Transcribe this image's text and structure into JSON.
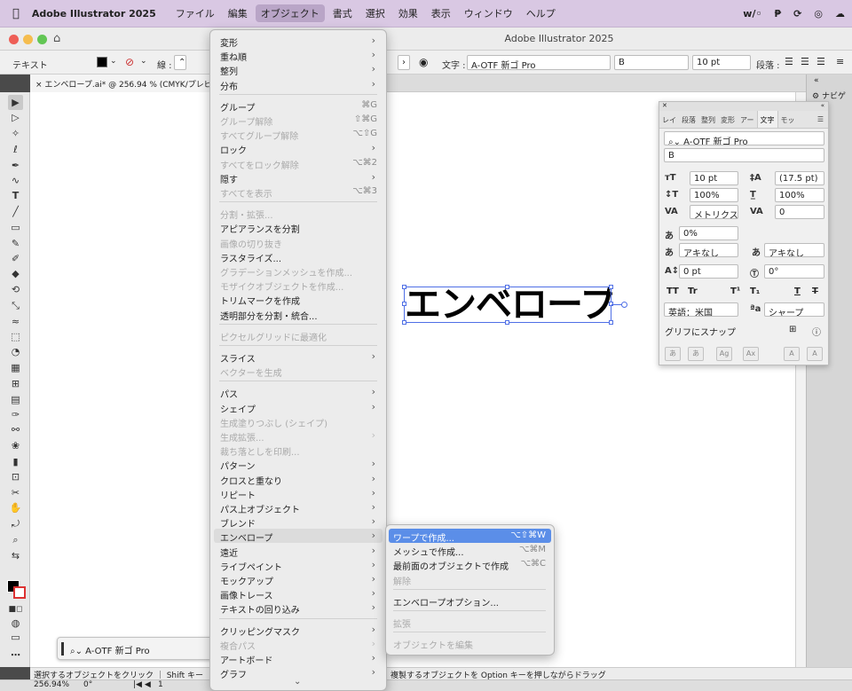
{
  "menubar": {
    "app": "Adobe Illustrator 2025",
    "items": [
      "ファイル",
      "編集",
      "オブジェクト",
      "書式",
      "選択",
      "効果",
      "表示",
      "ウィンドウ",
      "ヘルプ"
    ],
    "active_index": 2
  },
  "window": {
    "title": "Adobe Illustrator 2025"
  },
  "control": {
    "label": "テキスト",
    "stroke_label": "線 :",
    "char_label": "文字 :",
    "font": "A-OTF 新ゴ Pro",
    "style": "B",
    "size": "10 pt",
    "para_label": "段落 :"
  },
  "document": {
    "tab": "エンベロープ.ai* @ 256.94 % (CMYK/プレビュー)",
    "text": "エンベロープ"
  },
  "navigator": {
    "label": "ナビゲ"
  },
  "floating": {
    "font": "A-OTF 新ゴ Pro"
  },
  "char_panel": {
    "tabs": [
      "レイ",
      "段落",
      "整列",
      "変形",
      "アー",
      "文字",
      "モッ"
    ],
    "active_tab": 5,
    "font": "A-OTF 新ゴ Pro",
    "style": "B",
    "size": "10 pt",
    "leading": "(17.5 pt)",
    "vscale": "100%",
    "hscale": "100%",
    "kerning": "メトリクス",
    "tracking": "0",
    "tsume": "0%",
    "aki_left": "アキなし",
    "aki_right": "アキなし",
    "baseline": "0 pt",
    "rotation": "0°",
    "language": "英語：米国",
    "antialias": "シャープ",
    "glyph_snap": "グリフにスナップ",
    "fmt": {
      "tt": "TT",
      "tr": "Tr",
      "sup": "T¹",
      "sub": "T₁",
      "und": "T",
      "strike": "T"
    }
  },
  "menu": {
    "items": [
      {
        "label": "変形",
        "arrow": true
      },
      {
        "label": "重ね順",
        "arrow": true
      },
      {
        "label": "整列",
        "arrow": true
      },
      {
        "label": "分布",
        "arrow": true
      },
      {
        "sep": true
      },
      {
        "label": "グループ",
        "shortcut": "⌘G"
      },
      {
        "label": "グループ解除",
        "shortcut": "⇧⌘G",
        "disabled": true
      },
      {
        "label": "すべてグループ解除",
        "shortcut": "⌥⇧G",
        "disabled": true
      },
      {
        "label": "ロック",
        "arrow": true
      },
      {
        "label": "すべてをロック解除",
        "shortcut": "⌥⌘2",
        "disabled": true
      },
      {
        "label": "隠す",
        "arrow": true
      },
      {
        "label": "すべてを表示",
        "shortcut": "⌥⌘3",
        "disabled": true
      },
      {
        "sep": true
      },
      {
        "label": "分割・拡張...",
        "disabled": true
      },
      {
        "label": "アピアランスを分割"
      },
      {
        "label": "画像の切り抜き",
        "disabled": true
      },
      {
        "label": "ラスタライズ..."
      },
      {
        "label": "グラデーションメッシュを作成...",
        "disabled": true
      },
      {
        "label": "モザイクオブジェクトを作成...",
        "disabled": true
      },
      {
        "label": "トリムマークを作成"
      },
      {
        "label": "透明部分を分割・統合..."
      },
      {
        "sep": true
      },
      {
        "label": "ピクセルグリッドに最適化",
        "disabled": true
      },
      {
        "sep": true
      },
      {
        "label": "スライス",
        "arrow": true
      },
      {
        "label": "ベクターを生成",
        "disabled": true
      },
      {
        "sep": true
      },
      {
        "label": "パス",
        "arrow": true
      },
      {
        "label": "シェイプ",
        "arrow": true
      },
      {
        "label": "生成塗りつぶし (シェイプ)",
        "disabled": true
      },
      {
        "label": "生成拡張...",
        "arrow": true,
        "disabled": true
      },
      {
        "label": "裁ち落としを印刷...",
        "disabled": true
      },
      {
        "label": "パターン",
        "arrow": true
      },
      {
        "label": "クロスと重なり",
        "arrow": true
      },
      {
        "label": "リピート",
        "arrow": true
      },
      {
        "label": "パス上オブジェクト",
        "arrow": true
      },
      {
        "label": "ブレンド",
        "arrow": true
      },
      {
        "label": "エンベロープ",
        "arrow": true,
        "highlight": true
      },
      {
        "label": "遠近",
        "arrow": true
      },
      {
        "label": "ライブペイント",
        "arrow": true
      },
      {
        "label": "モックアップ",
        "arrow": true
      },
      {
        "label": "画像トレース",
        "arrow": true
      },
      {
        "label": "テキストの回り込み",
        "arrow": true
      },
      {
        "sep": true
      },
      {
        "label": "クリッピングマスク",
        "arrow": true
      },
      {
        "label": "複合パス",
        "arrow": true,
        "disabled": true
      },
      {
        "label": "アートボード",
        "arrow": true
      },
      {
        "label": "グラフ",
        "arrow": true
      }
    ],
    "more": "⌄"
  },
  "submenu": {
    "items": [
      {
        "label": "ワープで作成...",
        "shortcut": "⌥⇧⌘W",
        "selected": true
      },
      {
        "label": "メッシュで作成...",
        "shortcut": "⌥⌘M"
      },
      {
        "label": "最前面のオブジェクトで作成",
        "shortcut": "⌥⌘C"
      },
      {
        "label": "解除",
        "disabled": true
      },
      {
        "sep": true
      },
      {
        "label": "エンベロープオプション..."
      },
      {
        "sep": true
      },
      {
        "label": "拡張",
        "disabled": true
      },
      {
        "sep": true
      },
      {
        "label": "オブジェクトを編集",
        "disabled": true
      }
    ]
  },
  "status": {
    "left": "選択するオブジェクトをクリック ｜ Shift キー",
    "right": "複製するオブジェクトを Option キーを押しながらドラッグ",
    "zoom": "256.94%",
    "angle": "0°",
    "page": "1"
  },
  "colors": {
    "selection": "#4f6fe6",
    "menu_highlight": "#5b8ee8",
    "menubar": "#d9c8e3"
  }
}
